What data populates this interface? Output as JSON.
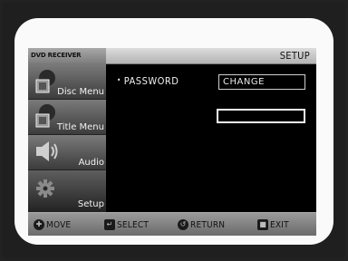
{
  "osd": {
    "brand": "DVD RECEIVER",
    "section_title": "SETUP",
    "menu": [
      {
        "label": "Disc Menu",
        "icon": "disc-icon"
      },
      {
        "label": "Title Menu",
        "icon": "title-icon"
      },
      {
        "label": "Audio",
        "icon": "speaker-icon"
      },
      {
        "label": "Setup",
        "icon": "gear-icon",
        "active": true
      }
    ],
    "password": {
      "label": "PASSWORD",
      "button": "CHANGE",
      "input_value": ""
    },
    "footer": [
      {
        "label": "MOVE",
        "icon": "dpad-icon"
      },
      {
        "label": "SELECT",
        "icon": "enter-icon"
      },
      {
        "label": "RETURN",
        "icon": "return-icon"
      },
      {
        "label": "EXIT",
        "icon": "exit-icon"
      }
    ]
  }
}
